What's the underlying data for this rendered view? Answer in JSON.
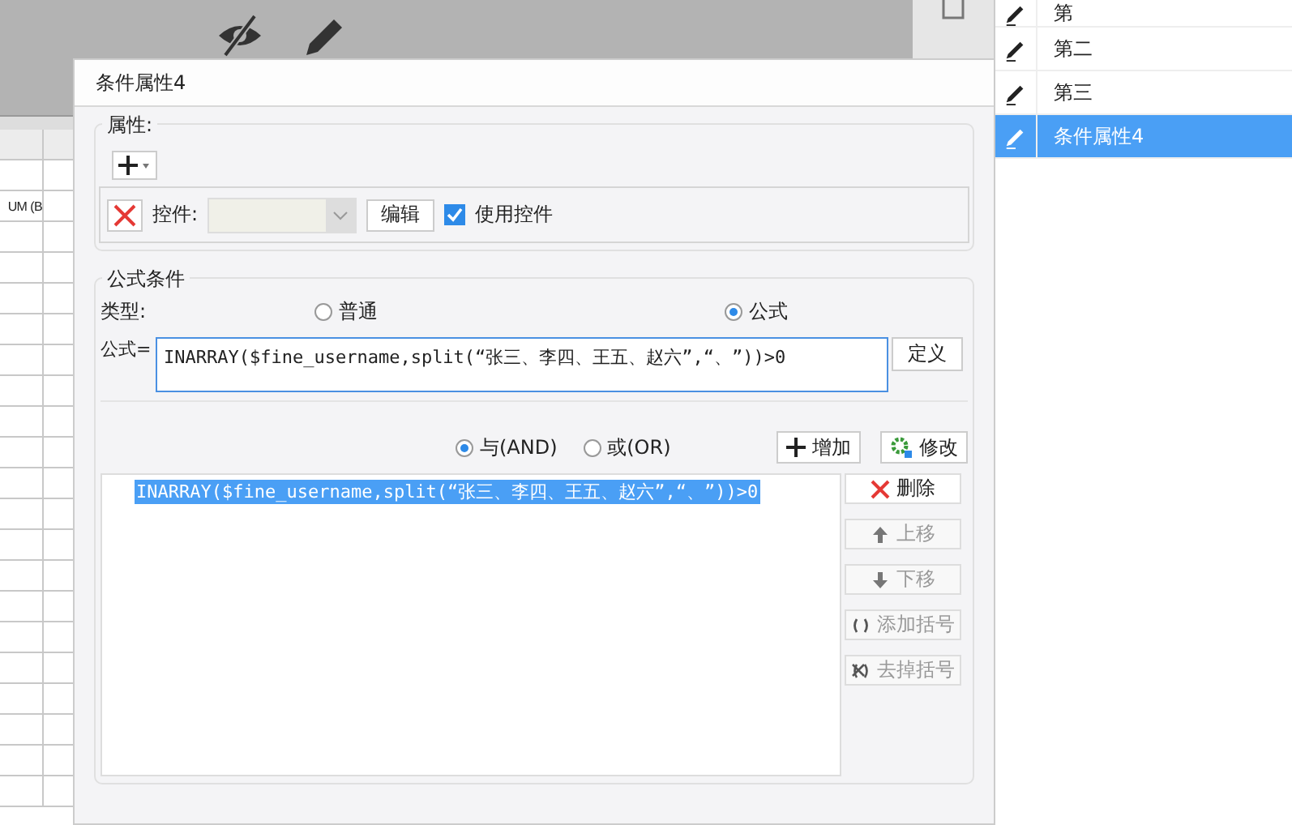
{
  "sheet": {
    "cell_text": "UM (B"
  },
  "condition_list": [
    {
      "label": "第",
      "selected": false
    },
    {
      "label": "第二",
      "selected": false
    },
    {
      "label": "第三",
      "selected": false
    },
    {
      "label": "条件属性4",
      "selected": true
    }
  ],
  "dialog": {
    "title": "条件属性4",
    "properties": {
      "legend": "属性:",
      "control_label": "控件:",
      "edit_button": "编辑",
      "use_control": {
        "label": "使用控件",
        "checked": true
      }
    },
    "formula_condition": {
      "legend": "公式条件",
      "type_label": "类型:",
      "types": [
        {
          "label": "普通",
          "selected": false
        },
        {
          "label": "公式",
          "selected": true
        }
      ],
      "formula_label": "公式=",
      "formula_value": "INARRAY($fine_username,split(“张三、李四、王五、赵六”,“、”))>0",
      "define_button": "定义",
      "joins": [
        {
          "label": "与(AND)",
          "selected": true
        },
        {
          "label": "或(OR)",
          "selected": false
        }
      ],
      "add_button": "增加",
      "modify_button": "修改",
      "conditions": [
        {
          "text": "INARRAY($fine_username,split(“张三、李四、王五、赵六”,“、”))>0",
          "selected": true
        }
      ],
      "actions": [
        {
          "kind": "delete",
          "label": "删除",
          "disabled": false
        },
        {
          "kind": "up",
          "label": "上移",
          "disabled": true
        },
        {
          "kind": "down",
          "label": "下移",
          "disabled": true
        },
        {
          "kind": "add-brackets",
          "label": "添加括号",
          "disabled": true
        },
        {
          "kind": "remove-brackets",
          "label": "去掉括号",
          "disabled": true
        }
      ]
    }
  }
}
